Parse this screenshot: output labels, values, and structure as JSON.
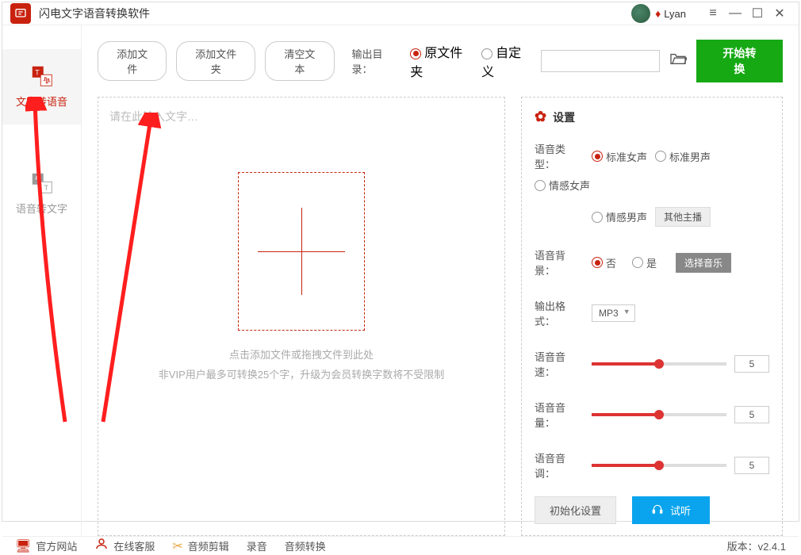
{
  "titlebar": {
    "app_name": "闪电文字语音转换软件",
    "username": "Lyan"
  },
  "sidebar": {
    "items": [
      {
        "label": "文字转语音"
      },
      {
        "label": "语音转文字"
      }
    ]
  },
  "toolbar": {
    "add_file": "添加文件",
    "add_folder": "添加文件夹",
    "clear_text": "清空文本",
    "output_dir_label": "输出目录：",
    "output_original": "原文件夹",
    "output_custom": "自定义",
    "start": "开始转换"
  },
  "dropzone": {
    "placeholder": "请在此输入文字…",
    "hint1": "点击添加文件或拖拽文件到此处",
    "hint2": "非VIP用户最多可转换25个字，升级为会员转换字数将不受限制"
  },
  "settings": {
    "title": "设置",
    "voice_type_label": "语音类型：",
    "voice_types": [
      "标准女声",
      "标准男声",
      "情感女声",
      "情感男声"
    ],
    "other_anchor": "其他主播",
    "voice_bg_label": "语音背景：",
    "bg_no": "否",
    "bg_yes": "是",
    "select_music": "选择音乐",
    "output_format_label": "输出格式：",
    "output_format": "MP3",
    "speed_label": "语音音速：",
    "speed_value": "5",
    "volume_label": "语音音量：",
    "volume_value": "5",
    "pitch_label": "语音音调：",
    "pitch_value": "5",
    "init_btn": "初始化设置",
    "listen_btn": "试听"
  },
  "footer": {
    "official_site": "官方网站",
    "online_support": "在线客服",
    "audio_edit": "音频剪辑",
    "record": "录音",
    "audio_convert": "音频转换",
    "version_label": "版本：",
    "version": "v2.4.1"
  }
}
